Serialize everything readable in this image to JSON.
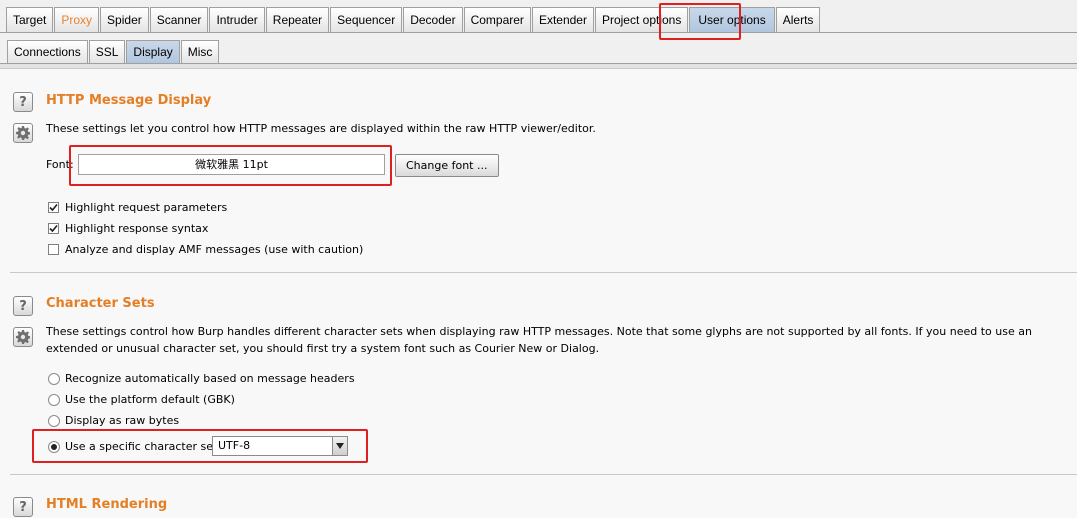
{
  "top_tabs": [
    {
      "label": "Target"
    },
    {
      "label": "Proxy",
      "accent": true
    },
    {
      "label": "Spider"
    },
    {
      "label": "Scanner"
    },
    {
      "label": "Intruder"
    },
    {
      "label": "Repeater"
    },
    {
      "label": "Sequencer"
    },
    {
      "label": "Decoder"
    },
    {
      "label": "Comparer"
    },
    {
      "label": "Extender"
    },
    {
      "label": "Project options"
    },
    {
      "label": "User options",
      "selected": true
    },
    {
      "label": "Alerts"
    }
  ],
  "sub_tabs": [
    {
      "label": "Connections"
    },
    {
      "label": "SSL"
    },
    {
      "label": "Display",
      "selected": true
    },
    {
      "label": "Misc"
    }
  ],
  "icons": {
    "help": "?",
    "settings": "gear-icon"
  },
  "colors": {
    "accent": "#e47f25",
    "highlight_box": "#e02020",
    "selected_tab": "#b9cce2"
  },
  "http_message_display": {
    "title": "HTTP Message Display",
    "description": "These settings let you control how HTTP messages are displayed within the raw HTTP viewer/editor.",
    "font_label": "Font:",
    "font_value": "微软雅黑 11pt",
    "change_font_button": "Change font ...",
    "options": [
      {
        "label": "Highlight request parameters",
        "checked": true
      },
      {
        "label": "Highlight response syntax",
        "checked": true
      },
      {
        "label": "Analyze and display AMF messages (use with caution)",
        "checked": false
      }
    ]
  },
  "character_sets": {
    "title": "Character Sets",
    "description": "These settings control how Burp handles different character sets when displaying raw HTTP messages. Note that some glyphs are not supported by all fonts. If you need to use an extended or unusual character set, you should first try a system font such as Courier New or Dialog.",
    "radio_options": [
      {
        "label": "Recognize automatically based on message headers",
        "selected": false
      },
      {
        "label": "Use the platform default (GBK)",
        "selected": false
      },
      {
        "label": "Display as raw bytes",
        "selected": false
      },
      {
        "label": "Use a specific character set:",
        "selected": true
      }
    ],
    "charset_value": "UTF-8"
  },
  "html_rendering": {
    "title": "HTML Rendering"
  }
}
